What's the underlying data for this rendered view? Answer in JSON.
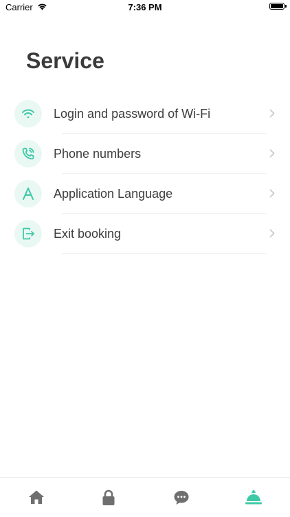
{
  "status_bar": {
    "carrier": "Carrier",
    "time": "7:36 PM"
  },
  "page": {
    "title": "Service"
  },
  "menu": {
    "items": [
      {
        "label": "Login and password of Wi-Fi",
        "icon": "wifi-icon"
      },
      {
        "label": "Phone numbers",
        "icon": "phone-icon"
      },
      {
        "label": "Application Language",
        "icon": "language-icon"
      },
      {
        "label": "Exit booking",
        "icon": "exit-icon"
      }
    ]
  },
  "tab_bar": {
    "tabs": [
      {
        "icon": "home-icon",
        "active": false
      },
      {
        "icon": "lock-icon",
        "active": false
      },
      {
        "icon": "chat-icon",
        "active": false
      },
      {
        "icon": "service-bell-icon",
        "active": true
      }
    ]
  },
  "colors": {
    "accent": "#3ec9a7",
    "icon_bg": "#eaf8f4",
    "inactive_tab": "#6f6f6f",
    "chevron": "#c7c7cc"
  }
}
